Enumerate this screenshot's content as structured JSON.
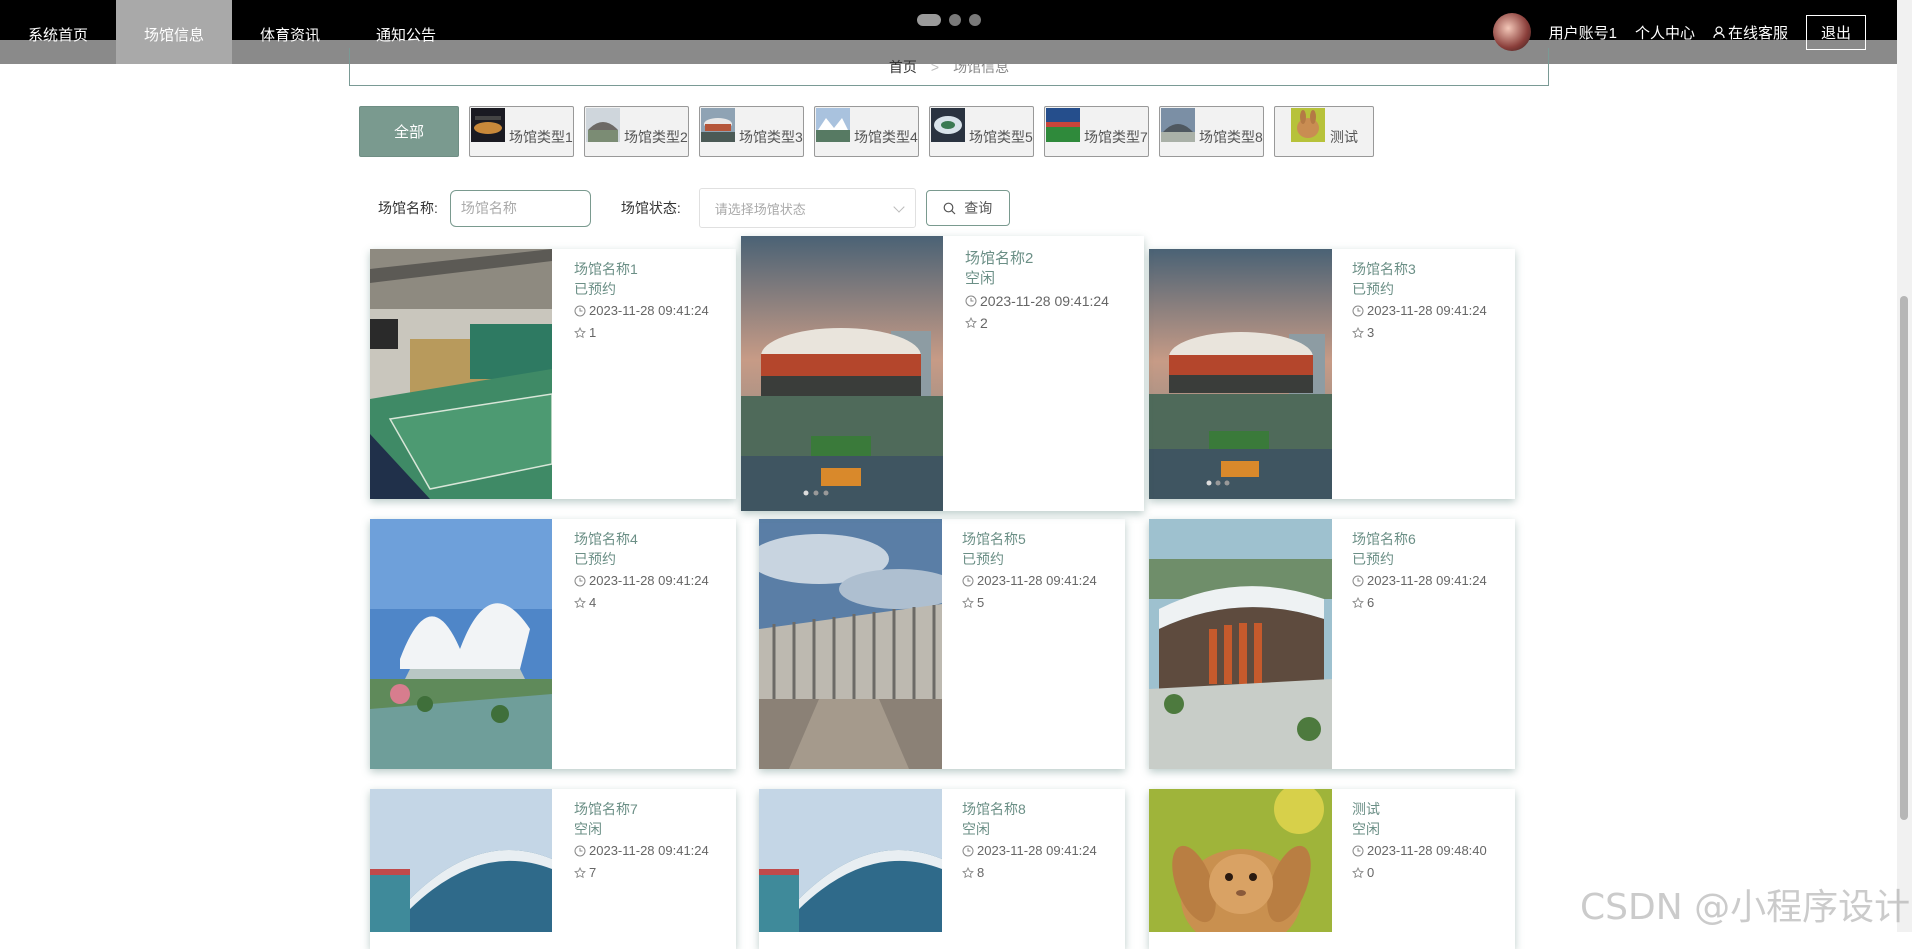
{
  "nav": {
    "items": [
      {
        "label": "系统首页",
        "active": false
      },
      {
        "label": "场馆信息",
        "active": true
      },
      {
        "label": "体育资讯",
        "active": false
      },
      {
        "label": "通知公告",
        "active": false
      }
    ]
  },
  "user": {
    "account": "用户账号1",
    "center": "个人中心",
    "service": "在线客服",
    "logout": "退出"
  },
  "breadcrumb": {
    "home": "首页",
    "separator": ">",
    "current": "场馆信息"
  },
  "tabs": {
    "all": "全部",
    "items": [
      "场馆类型1",
      "场馆类型2",
      "场馆类型3",
      "场馆类型4",
      "场馆类型5",
      "场馆类型7",
      "场馆类型8",
      "测试"
    ]
  },
  "search": {
    "name_label": "场馆名称:",
    "name_placeholder": "场馆名称",
    "status_label": "场馆状态:",
    "status_placeholder": "请选择场馆状态",
    "query_button": "查询"
  },
  "venues": [
    {
      "name": "场馆名称1",
      "status": "已预约",
      "time": "2023-11-28 09:41:24",
      "likes": "1"
    },
    {
      "name": "场馆名称2",
      "status": "空闲",
      "time": "2023-11-28 09:41:24",
      "likes": "2"
    },
    {
      "name": "场馆名称3",
      "status": "已预约",
      "time": "2023-11-28 09:41:24",
      "likes": "3"
    },
    {
      "name": "场馆名称4",
      "status": "已预约",
      "time": "2023-11-28 09:41:24",
      "likes": "4"
    },
    {
      "name": "场馆名称5",
      "status": "已预约",
      "time": "2023-11-28 09:41:24",
      "likes": "5"
    },
    {
      "name": "场馆名称6",
      "status": "已预约",
      "time": "2023-11-28 09:41:24",
      "likes": "6"
    },
    {
      "name": "场馆名称7",
      "status": "空闲",
      "time": "2023-11-28 09:41:24",
      "likes": "7"
    },
    {
      "name": "场馆名称8",
      "status": "空闲",
      "time": "2023-11-28 09:41:24",
      "likes": "8"
    },
    {
      "name": "测试",
      "status": "空闲",
      "time": "2023-11-28 09:48:40",
      "likes": "0"
    }
  ],
  "watermark": "CSDN @小程序设计",
  "colors": {
    "accent": "#7a9a8f",
    "text_accent": "#6b8f86"
  }
}
